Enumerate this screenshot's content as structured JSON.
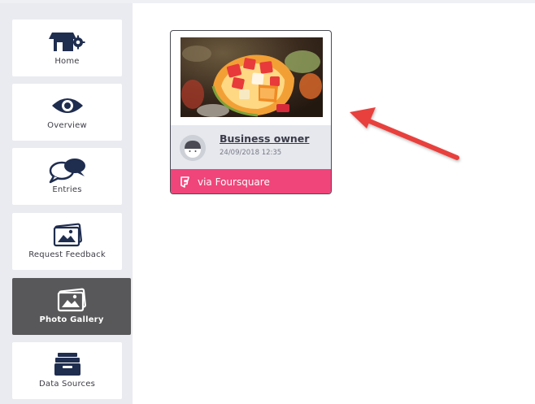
{
  "sidebar": {
    "items": [
      {
        "label": "Home",
        "icon": "shop-settings-icon",
        "active": false
      },
      {
        "label": "Overview",
        "icon": "eye-icon",
        "active": false
      },
      {
        "label": "Entries",
        "icon": "chat-bubbles-icon",
        "active": false
      },
      {
        "label": "Request Feedback",
        "icon": "photo-stack-icon",
        "active": false
      },
      {
        "label": "Photo Gallery",
        "icon": "photo-stack-icon",
        "active": true
      },
      {
        "label": "Data Sources",
        "icon": "archive-box-icon",
        "active": false
      }
    ]
  },
  "gallery": {
    "card": {
      "author": "Business owner",
      "date": "24/09/2018 12:35",
      "source": "via Foursquare",
      "photo_icon": "fruit-photo"
    }
  },
  "colors": {
    "sidebar_bg": "#eaebf0",
    "active_item": "#58585a",
    "foursquare_pink": "#f0457a",
    "arrow_red": "#e8413c",
    "icon_navy": "#1f2d4f"
  }
}
